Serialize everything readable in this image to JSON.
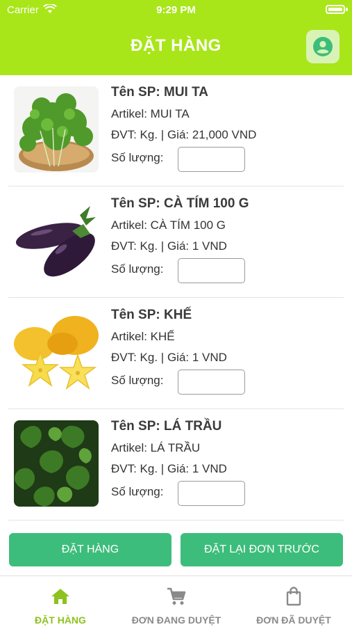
{
  "status_bar": {
    "carrier": "Carrier",
    "time": "9:29 PM"
  },
  "header": {
    "title": "ĐẶT HÀNG",
    "account_icon": "account-circle-icon"
  },
  "colors": {
    "header": "#a8e619",
    "button": "#3dbd7b",
    "tab_active": "#8dc21f",
    "tab_inactive": "#8a8a8a"
  },
  "products": [
    {
      "name": "Tên SP: MUI TA",
      "artikel": "Artikel: MUI TA",
      "dvt": "ĐVT: Kg.  |  Giá: 21,000 VND",
      "qty_label": "Số lượng:",
      "qty_value": ""
    },
    {
      "name": "Tên SP: CÀ TÍM 100 G",
      "artikel": "Artikel: CÀ TÍM 100 G",
      "dvt": "ĐVT: Kg.  |  Giá: 1 VND",
      "qty_label": "Số lượng:",
      "qty_value": ""
    },
    {
      "name": "Tên SP: KHẾ",
      "artikel": "Artikel: KHẾ",
      "dvt": "ĐVT: Kg.  |  Giá: 1 VND",
      "qty_label": "Số lượng:",
      "qty_value": ""
    },
    {
      "name": "Tên SP: LÁ TRẦU",
      "artikel": "Artikel: LÁ TRẦU",
      "dvt": "ĐVT: Kg.  |  Giá: 1 VND",
      "qty_label": "Số lượng:",
      "qty_value": ""
    }
  ],
  "buttons": {
    "order": "ĐẶT HÀNG",
    "reorder": "ĐẶT LẠI ĐƠN TRƯỚC"
  },
  "tabs": [
    {
      "label": "ĐẶT HÀNG",
      "icon": "home-icon",
      "active": true
    },
    {
      "label": "ĐƠN ĐANG DUYỆT",
      "icon": "cart-icon",
      "active": false
    },
    {
      "label": "ĐƠN ĐÃ DUYỆT",
      "icon": "shopping-bag-icon",
      "active": false
    }
  ]
}
